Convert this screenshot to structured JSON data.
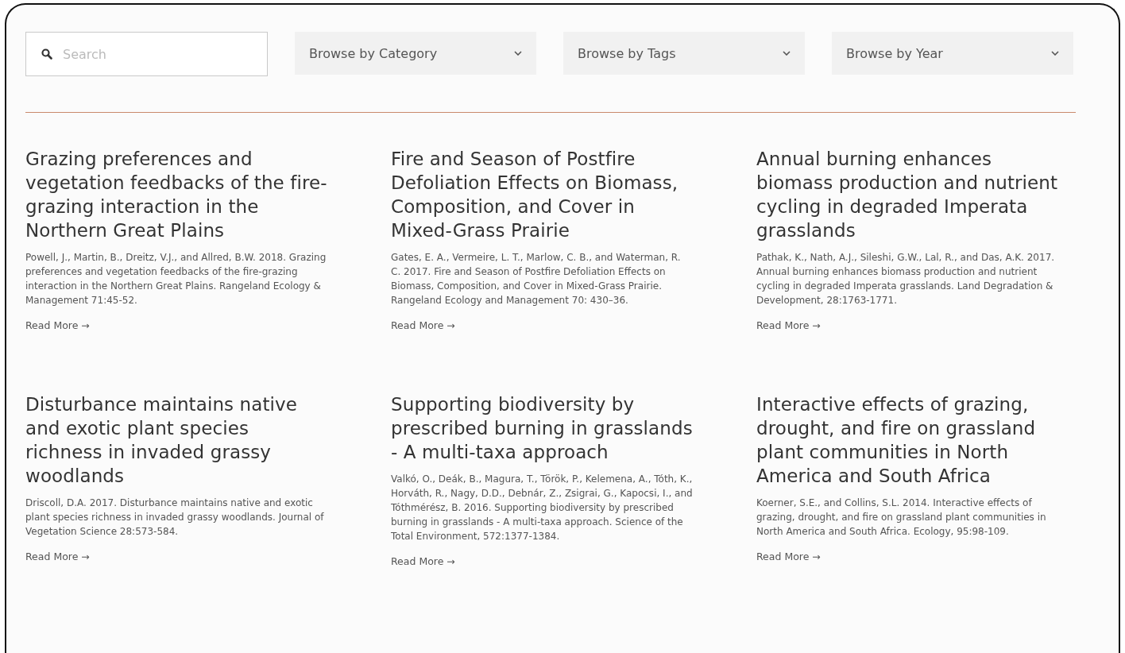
{
  "search": {
    "placeholder": "Search"
  },
  "filters": [
    {
      "label": "Browse by Category"
    },
    {
      "label": "Browse by Tags"
    },
    {
      "label": "Browse by Year"
    }
  ],
  "articles": [
    {
      "title": "Grazing preferences and vegetation feedbacks of the fire-grazing interaction in the Northern Great Plains",
      "citation": "Powell, J., Martin, B., Dreitz, V.J., and Allred, B.W. 2018. Grazing preferences and vegetation feedbacks of the fire-grazing interaction in the Northern Great Plains. Rangeland Ecology & Management 71:45-52.",
      "link": "Read More →"
    },
    {
      "title": "Fire and Season of Postfire Defoliation Effects on Biomass, Composition, and Cover in Mixed-Grass Prairie",
      "citation": "Gates, E. A., Vermeire, L. T., Marlow, C. B., and Waterman, R. C. 2017. Fire and Season of Postfire Defoliation Effects on Biomass, Composition, and Cover in Mixed-Grass Prairie. Rangeland Ecology and Management 70: 430–36.",
      "link": "Read More →"
    },
    {
      "title": "Annual burning enhances biomass production and nutrient cycling in degraded Imperata grasslands",
      "citation": "Pathak, K., Nath, A.J., Sileshi, G.W., Lal, R., and Das, A.K. 2017. Annual burning enhances biomass production and nutrient cycling in degraded Imperata grasslands. Land Degradation & Development, 28:1763-1771.",
      "link": "Read More →"
    },
    {
      "title": "Disturbance maintains native and exotic plant species richness in invaded grassy woodlands",
      "citation": "Driscoll, D.A. 2017. Disturbance maintains native and exotic plant species richness in invaded grassy woodlands. Journal of Vegetation Science 28:573-584.",
      "link": "Read More →"
    },
    {
      "title": "Supporting biodiversity by prescribed burning in grasslands - A multi-taxa approach",
      "citation": "Valkó, O., Deák, B., Magura, T., Török, P., Kelemena, A., Tóth, K., Horváth, R., Nagy, D.D., Debnár, Z., Zsigrai, G., Kapocsi, I., and Tóthmérész, B. 2016. Supporting biodiversity by prescribed burning in grasslands - A multi-taxa approach. Science of the Total Environment, 572:1377-1384.",
      "link": "Read More →"
    },
    {
      "title": "Interactive effects of grazing, drought, and fire on grassland plant communities in North America and South Africa",
      "citation": "Koerner, S.E., and Collins, S.L. 2014. Interactive effects of grazing, drought, and fire on grassland plant communities in North America and South Africa. Ecology, 95:98-109.",
      "link": "Read More →"
    }
  ]
}
